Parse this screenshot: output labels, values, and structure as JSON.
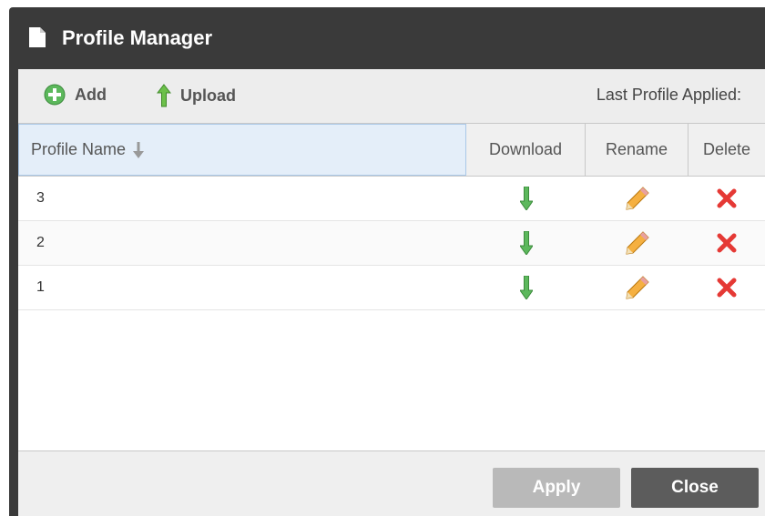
{
  "dialog": {
    "title": "Profile Manager",
    "title_icon": "document-icon"
  },
  "toolbar": {
    "add_label": "Add",
    "add_icon": "plus-circle-icon",
    "upload_label": "Upload",
    "upload_icon": "arrow-up-icon",
    "last_profile_label": "Last Profile Applied:"
  },
  "table": {
    "columns": [
      "Profile Name",
      "Download",
      "Rename",
      "Delete"
    ],
    "sort_icon": "sort-down-arrow-icon",
    "rows": [
      {
        "name": "3"
      },
      {
        "name": "2"
      },
      {
        "name": "1"
      }
    ],
    "row_icons": {
      "download": "download-arrow-icon",
      "rename": "pencil-icon",
      "delete": "red-x-icon"
    }
  },
  "footer": {
    "apply_label": "Apply",
    "close_label": "Close"
  },
  "colors": {
    "titlebar": "#3a3a3a",
    "download_green": "#4caf50",
    "delete_red": "#e53935",
    "pencil_orange": "#f0a030",
    "apply_disabled": "#b9b9b9",
    "close_button": "#5c5c5c"
  }
}
